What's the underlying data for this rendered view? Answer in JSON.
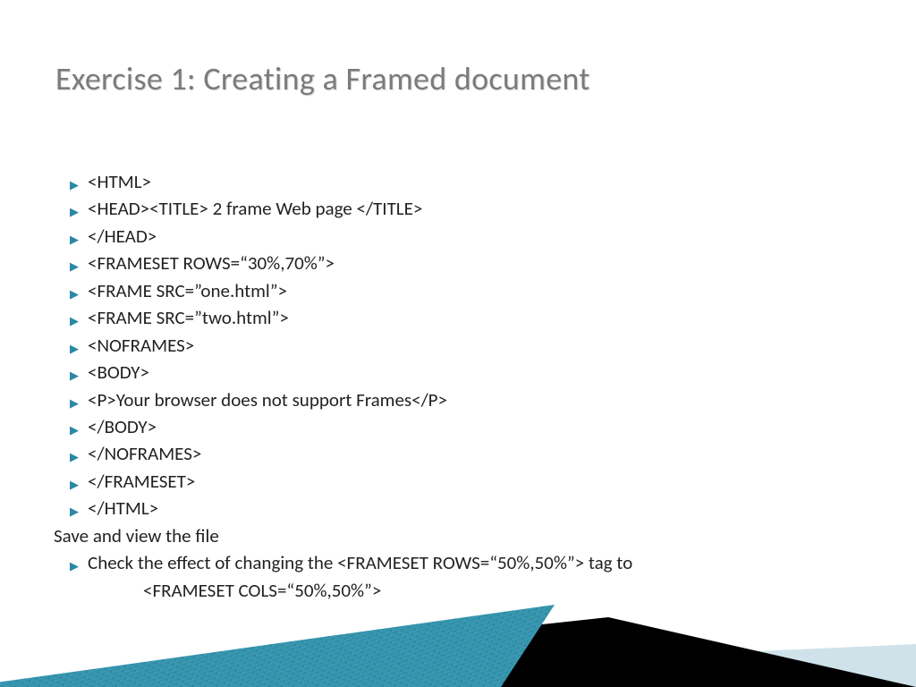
{
  "title": "Exercise 1: Creating a Framed document",
  "lines": [
    {
      "bullet": true,
      "text": "<HTML>"
    },
    {
      "bullet": true,
      "text": "<HEAD><TITLE> 2 frame Web page </TITLE>"
    },
    {
      "bullet": true,
      "text": "</HEAD>"
    },
    {
      "bullet": true,
      "text": "<FRAMESET ROWS=“30%,70%”>"
    },
    {
      "bullet": true,
      "text": "<FRAME SRC=”one.html”>"
    },
    {
      "bullet": true,
      "text": "<FRAME SRC=”two.html”>"
    },
    {
      "bullet": true,
      "text": "<NOFRAMES>"
    },
    {
      "bullet": true,
      "text": "<BODY>"
    },
    {
      "bullet": true,
      "text": "<P>Your browser does not support Frames</P>"
    },
    {
      "bullet": true,
      "text": "</BODY>"
    },
    {
      "bullet": true,
      "text": "</NOFRAMES>"
    },
    {
      "bullet": true,
      "text": "</FRAMESET>"
    },
    {
      "bullet": true,
      "text": "</HTML>"
    }
  ],
  "plain_line": "Save and view the file",
  "last_bullet": "Check the effect of changing the <FRAMESET ROWS=“50%,50%”> tag to",
  "last_bullet_cont": "<FRAMESET COLS=“50%,50%”>"
}
